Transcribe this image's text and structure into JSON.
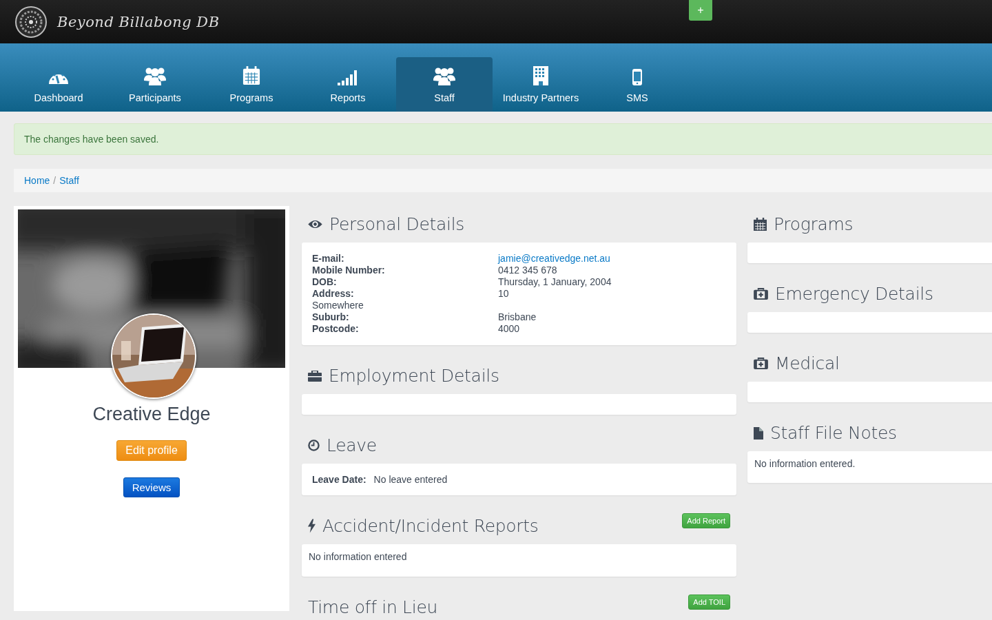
{
  "header": {
    "logo_text": "Beyond Billabong DB",
    "add_button": "+"
  },
  "nav": [
    {
      "label": "Dashboard",
      "kind": "gauge",
      "selected": false
    },
    {
      "label": "Participants",
      "kind": "group",
      "selected": false
    },
    {
      "label": "Programs",
      "kind": "calendar",
      "selected": false
    },
    {
      "label": "Reports",
      "kind": "signal",
      "selected": false
    },
    {
      "label": "Staff",
      "kind": "group",
      "selected": true
    },
    {
      "label": "Industry Partners",
      "kind": "building",
      "selected": false
    },
    {
      "label": "SMS",
      "kind": "phone",
      "selected": false
    }
  ],
  "alert": "The changes have been saved.",
  "breadcrumb": {
    "items": [
      "Home",
      "Staff"
    ],
    "separator": "/"
  },
  "profile": {
    "name": "Creative Edge",
    "buttons": [
      {
        "label": "Edit profile",
        "kind": "warning"
      },
      {
        "label": "Reviews",
        "kind": "primary"
      }
    ]
  },
  "middle": [
    {
      "title": "Personal Details",
      "kind": "details",
      "rows": [
        {
          "label": "E-mail:",
          "value": "jamie@creativedge.net.au",
          "kind": "link"
        },
        {
          "label": "Mobile Number:",
          "value": "0412 345 678",
          "kind": "text"
        },
        {
          "label": "DOB:",
          "value": "Thursday, 1 January, 2004",
          "kind": "text"
        },
        {
          "label": "Address:",
          "value": "10",
          "kind": "text"
        },
        {
          "value": "Somewhere",
          "kind": "continuation"
        },
        {
          "label": "Suburb:",
          "value": "Brisbane",
          "kind": "text"
        },
        {
          "label": "Postcode:",
          "value": "4000",
          "kind": "text"
        }
      ]
    },
    {
      "title": "Employment Details",
      "kind": "empty"
    },
    {
      "title": "Leave",
      "kind": "pair",
      "label": "Leave Date:",
      "value": "No leave entered"
    },
    {
      "title": "Accident/Incident Reports",
      "kind": "note",
      "button": "Add Report",
      "text": "No information entered"
    },
    {
      "title": "Time off in Lieu",
      "kind": "heading",
      "button": "Add TOIL"
    }
  ],
  "right": [
    {
      "title": "Programs",
      "kind": "empty"
    },
    {
      "title": "Emergency Details",
      "kind": "empty"
    },
    {
      "title": "Medical",
      "kind": "empty"
    },
    {
      "title": "Staff File Notes",
      "kind": "note",
      "text": "No information entered."
    }
  ]
}
